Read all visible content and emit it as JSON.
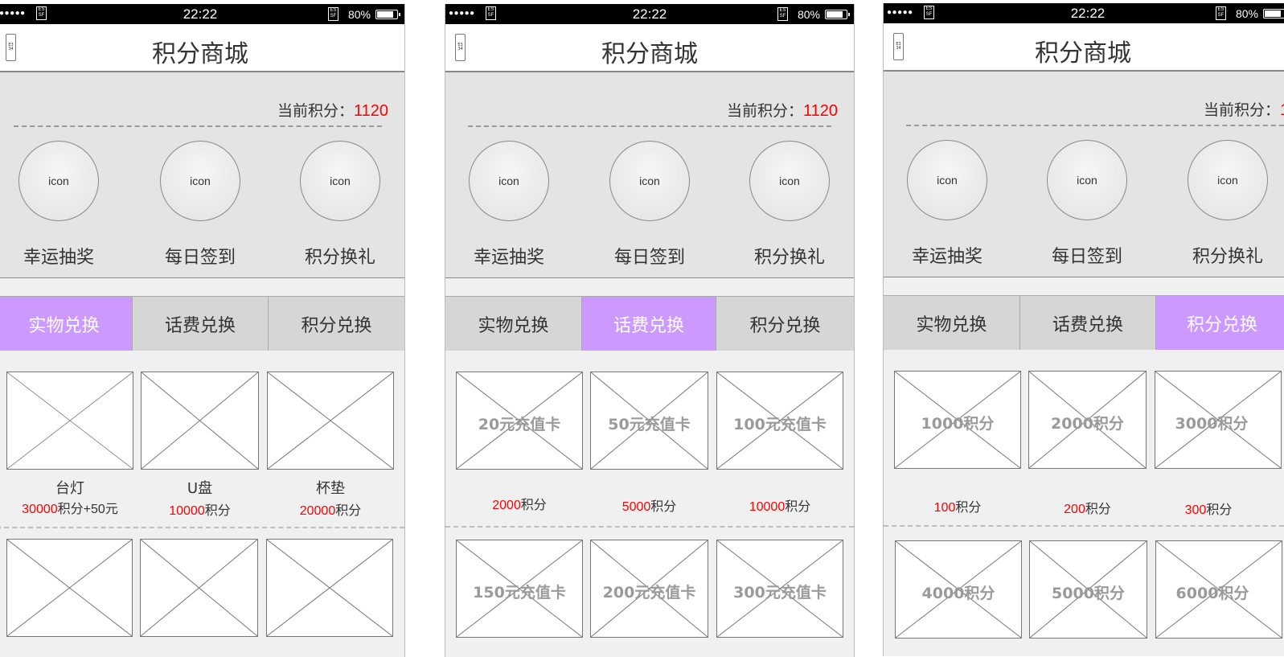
{
  "status_bar": {
    "signal": "●●●●●",
    "wifi_glyph": "ES SF",
    "time": "22:22",
    "bluetooth_glyph": "ES SF",
    "battery_percent": "80%",
    "battery_level": 0.8
  },
  "header": {
    "title": "积分商城",
    "back_glyph": "E3 34"
  },
  "summary": {
    "points_label": "当前积分：",
    "points_value": "1120",
    "features": [
      {
        "icon_text": "icon",
        "label": "幸运抽奖",
        "icon": "lottery-icon"
      },
      {
        "icon_text": "icon",
        "label": "每日签到",
        "icon": "checkin-icon"
      },
      {
        "icon_text": "icon",
        "label": "积分换礼",
        "icon": "gift-icon"
      }
    ]
  },
  "tabs": [
    "实物兑换",
    "话费兑换",
    "积分兑换"
  ],
  "colors": {
    "active_tab": "#cc99ff",
    "price_highlight": "#ff0000",
    "status_bar": "#000000"
  },
  "screens": [
    {
      "active_tab": 0,
      "items": [
        {
          "name": "台灯",
          "price_num": "30000",
          "price_unit": "积分+50元"
        },
        {
          "name": "U盘",
          "price_num": "10000",
          "price_unit": "积分"
        },
        {
          "name": "杯垫",
          "price_num": "20000",
          "price_unit": "积分"
        }
      ],
      "items_row2": [
        {
          "label": ""
        },
        {
          "label": ""
        },
        {
          "label": ""
        }
      ]
    },
    {
      "active_tab": 1,
      "items": [
        {
          "label": "20元充值卡",
          "price_num": "2000",
          "price_unit": "积分"
        },
        {
          "label": "50元充值卡",
          "price_num": "5000",
          "price_unit": "积分"
        },
        {
          "label": "100元充值卡",
          "price_num": "10000",
          "price_unit": "积分"
        }
      ],
      "items_row2": [
        {
          "label": "150元充值卡"
        },
        {
          "label": "200元充值卡"
        },
        {
          "label": "300元充值卡"
        }
      ]
    },
    {
      "active_tab": 2,
      "items": [
        {
          "label": "1000积分",
          "price_num": "100",
          "price_unit": "积分"
        },
        {
          "label": "2000积分",
          "price_num": "200",
          "price_unit": "积分"
        },
        {
          "label": "3000积分",
          "price_num": "300",
          "price_unit": "积分"
        }
      ],
      "items_row2": [
        {
          "label": "4000积分"
        },
        {
          "label": "5000积分"
        },
        {
          "label": "6000积分"
        }
      ]
    }
  ]
}
